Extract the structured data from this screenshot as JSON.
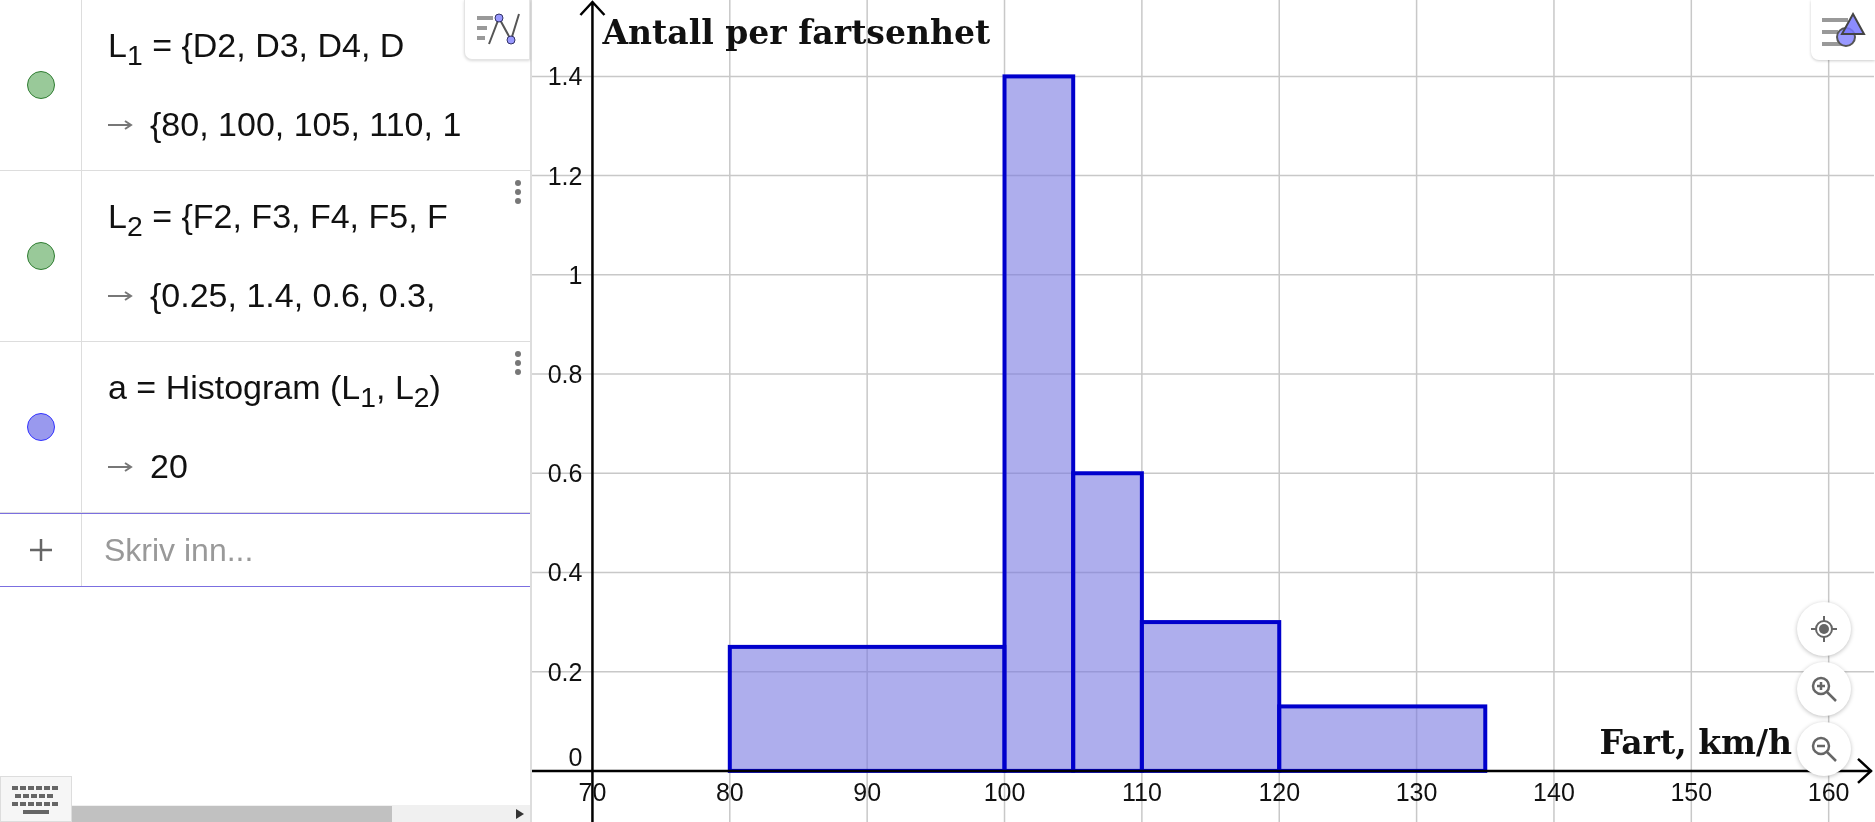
{
  "algebra": {
    "items": [
      {
        "definition": "L$_{1}$ = {D2, D3, D4, D",
        "value": "{80, 100, 105, 110, 1",
        "color": "#99c999",
        "menu": false
      },
      {
        "definition": "L$_{2}$ = {F2, F3, F4, F5, F",
        "value": "{0.25, 1.4, 0.6, 0.3,",
        "color": "#99c999",
        "menu": true
      },
      {
        "definition": "a = Histogram (L$_{1}$, L$_{2}$)",
        "value": "20",
        "color": "#9999ee",
        "menu": true
      }
    ],
    "input": {
      "placeholder": "Skriv inn..."
    }
  },
  "graphics": {
    "chart_data": {
      "type": "bar",
      "xlabel": "Fart, km/h",
      "ylabel": "Antall per fartsenhet",
      "x": [
        90,
        102.5,
        107.5,
        115,
        127.5
      ],
      "values": [
        0.25,
        1.4,
        0.6,
        0.3,
        0.13
      ],
      "grid": true,
      "xlim": [
        65.6,
        163.3
      ],
      "ylim": [
        -0.103,
        1.554
      ],
      "xticks": [
        70,
        80,
        90,
        100,
        110,
        120,
        130,
        140,
        150,
        160
      ],
      "yticks": [
        0,
        0.2,
        0.4,
        0.6,
        0.8,
        1,
        1.2,
        1.4
      ]
    }
  }
}
